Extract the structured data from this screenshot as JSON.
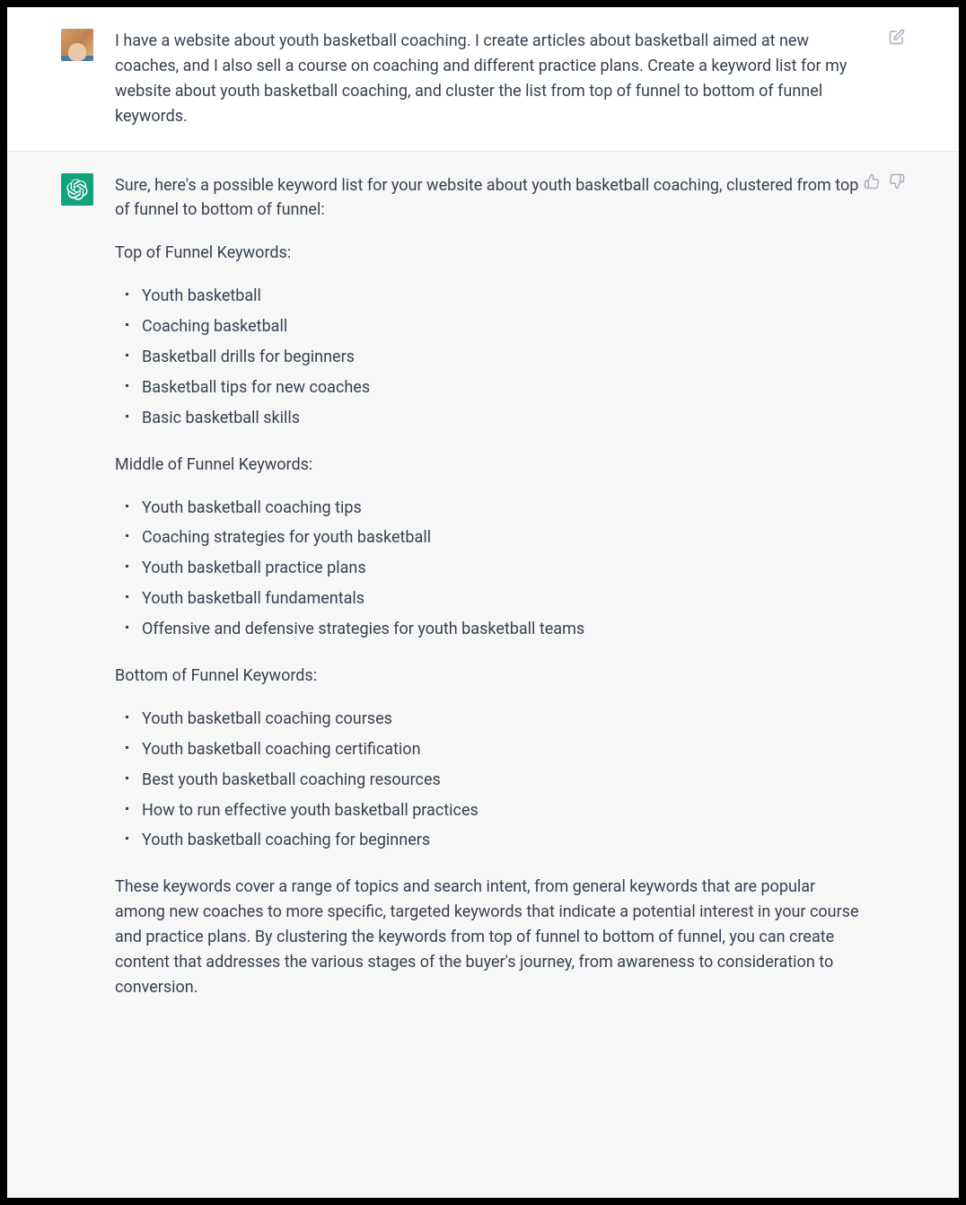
{
  "user_message": {
    "text": "I have a website about youth basketball coaching. I create articles about basketball aimed at new coaches, and I also sell a course on coaching and different practice plans. Create a keyword list for my website about youth basketball coaching, and cluster the list from top of funnel to bottom of funnel keywords."
  },
  "assistant_message": {
    "intro": "Sure, here's a possible keyword list for your website about youth basketball coaching, clustered from top of funnel to bottom of funnel:",
    "sections": [
      {
        "label": "Top of Funnel Keywords:",
        "items": [
          "Youth basketball",
          "Coaching basketball",
          "Basketball drills for beginners",
          "Basketball tips for new coaches",
          "Basic basketball skills"
        ]
      },
      {
        "label": "Middle of Funnel Keywords:",
        "items": [
          "Youth basketball coaching tips",
          "Coaching strategies for youth basketball",
          "Youth basketball practice plans",
          "Youth basketball fundamentals",
          "Offensive and defensive strategies for youth basketball teams"
        ]
      },
      {
        "label": "Bottom of Funnel Keywords:",
        "items": [
          "Youth basketball coaching courses",
          "Youth basketball coaching certification",
          "Best youth basketball coaching resources",
          "How to run effective youth basketball practices",
          "Youth basketball coaching for beginners"
        ]
      }
    ],
    "outro": "These keywords cover a range of topics and search intent, from general keywords that are popular among new coaches to more specific, targeted keywords that indicate a potential interest in your course and practice plans. By clustering the keywords from top of funnel to bottom of funnel, you can create content that addresses the various stages of the buyer's journey, from awareness to consideration to conversion."
  },
  "icons": {
    "edit": "edit-icon",
    "thumbs_up": "thumbs-up-icon",
    "thumbs_down": "thumbs-down-icon"
  }
}
